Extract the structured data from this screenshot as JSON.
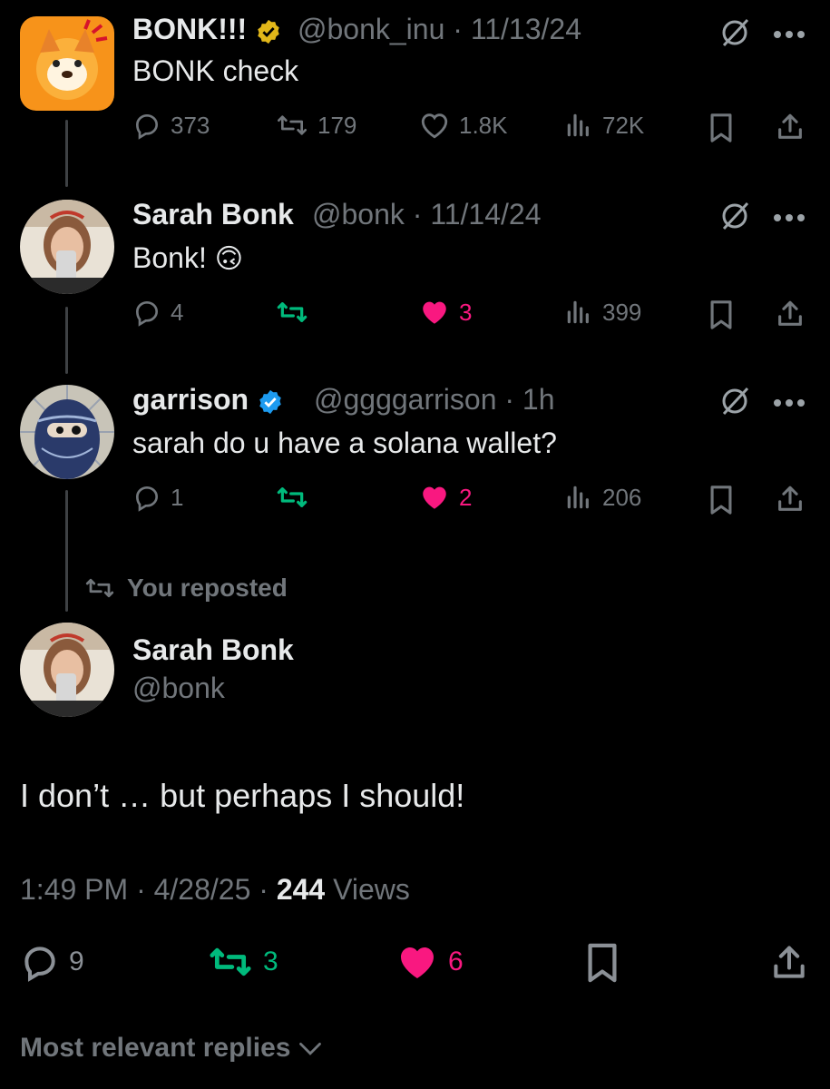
{
  "tweets": [
    {
      "name": "BONK!!!",
      "handle": "@bonk_inu",
      "date": "11/13/24",
      "text": "BONK check",
      "replies": "373",
      "reposts": "179",
      "likes": "1.8K",
      "views": "72K",
      "verified": "gold"
    },
    {
      "name": "Sarah Bonk",
      "handle": "@bonk",
      "date": "11/14/24",
      "text": "Bonk!",
      "emoji": "🙃",
      "replies": "4",
      "reposts": "",
      "likes": "3",
      "views": "399",
      "liked": true,
      "reposted": true
    },
    {
      "name": "garrison",
      "handle": "@ggggarrison",
      "date": "1h",
      "text": "sarah do u have a solana wallet?",
      "replies": "1",
      "reposts": "",
      "likes": "2",
      "views": "206",
      "verified": "blue",
      "liked": true,
      "reposted": true
    }
  ],
  "repost_label": "You reposted",
  "main": {
    "name": "Sarah Bonk",
    "handle": "@bonk",
    "text": "I don’t … but perhaps I should!",
    "time": "1:49 PM",
    "date": "4/28/25",
    "views_count": "244",
    "views_label": "Views",
    "replies": "9",
    "reposts": "3",
    "likes": "6"
  },
  "sort_label": "Most relevant replies",
  "colors": {
    "accent_like": "#f91880",
    "accent_repost": "#00ba7c",
    "muted": "#71767b",
    "text": "#e7e9ea",
    "verified_gold": "#e2b719",
    "verified_blue": "#1d9bf0"
  },
  "icons": [
    "grok-icon",
    "more-icon",
    "reply-icon",
    "repost-icon",
    "like-icon",
    "views-icon",
    "bookmark-icon",
    "share-icon",
    "chevron-down-icon"
  ]
}
